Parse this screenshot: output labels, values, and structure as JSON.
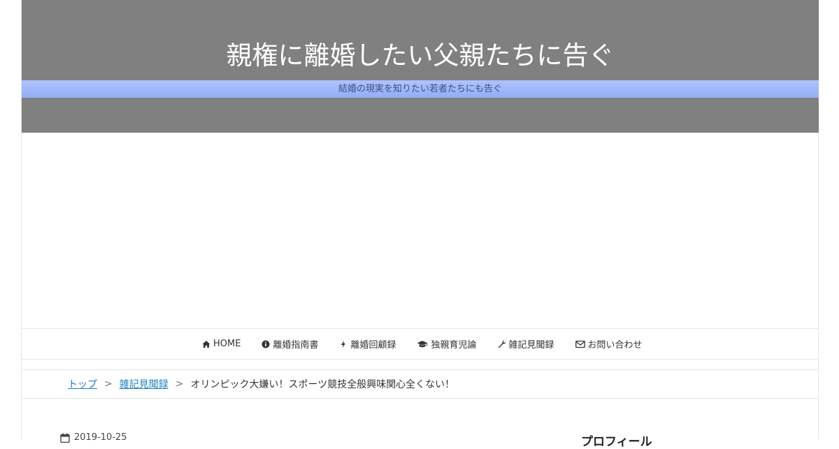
{
  "header": {
    "site_title": "親権に離婚したい父親たちに告ぐ",
    "tagline": "結婚の現実を知りたい若者たちにも告ぐ",
    "background_color": "#808080",
    "tagline_bar_color": "#9db5fb"
  },
  "nav": {
    "items": [
      {
        "label": "HOME",
        "icon": "home-icon"
      },
      {
        "label": "離婚指南書",
        "icon": "info-circle-icon"
      },
      {
        "label": "離婚回顧録",
        "icon": "bolt-icon"
      },
      {
        "label": "独親育児論",
        "icon": "graduation-cap-icon"
      },
      {
        "label": "雑記見聞録",
        "icon": "wrench-icon"
      },
      {
        "label": "お問い合わせ",
        "icon": "envelope-icon"
      }
    ]
  },
  "breadcrumb": {
    "top": "トップ",
    "category": "雑記見聞録",
    "current": "オリンピック大嫌い！スポーツ競技全般興味関心全くない！",
    "separator": ">"
  },
  "post": {
    "date": "2019-10-25"
  },
  "sidebar": {
    "heading": "プロフィール"
  },
  "colors": {
    "link": "#1e7fc0",
    "text": "#333333"
  }
}
